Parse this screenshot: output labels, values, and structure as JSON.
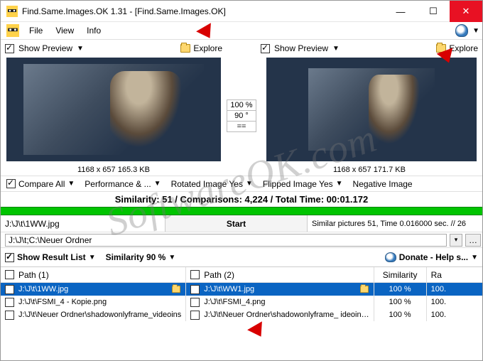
{
  "window": {
    "title": "Find.Same.Images.OK 1.31 - [Find.Same.Images.OK]",
    "min": "—",
    "max": "☐",
    "close": "✕"
  },
  "menu": {
    "file": "File",
    "view": "View",
    "info": "Info"
  },
  "preview": {
    "show": "Show Preview",
    "explore": "Explore",
    "left_info": "1168 x 657 165.3 KB",
    "right_info": "1168 x 657 171.7 KB",
    "zoom": "100 %",
    "rot": "90 °",
    "eq": "=="
  },
  "opts": {
    "compare": "Compare All",
    "perf": "Performance & ...",
    "rotated": "Rotated Image Yes",
    "flipped": "Flipped Image Yes",
    "negative": "Negative Image"
  },
  "summary": "Similarity: 51 / Comparisons: 4,224 / Total Time: 00:01.172",
  "control": {
    "current_path": "J:\\J\\t\\1WW.jpg",
    "start": "Start",
    "status": "Similar pictures 51, Time 0.016000 sec. // 26"
  },
  "scan_paths": "J:\\J\\t;C:\\Neuer Ordner",
  "result_opts": {
    "show_list": "Show Result List",
    "similarity": "Similarity 90 %",
    "donate": "Donate - Help s..."
  },
  "headers": {
    "path1": "Path (1)",
    "path2": "Path (2)",
    "sim": "Similarity",
    "ra": "Ra"
  },
  "rows": [
    {
      "p1": "J:\\J\\t\\1WW.jpg",
      "p2": "J:\\J\\t\\WW1.jpg",
      "sim": "100 %",
      "ra": "100.",
      "selected": true
    },
    {
      "p1": "J:\\J\\t\\FSMI_4 - Kopie.png",
      "p2": "J:\\J\\t\\FSMI_4.png",
      "sim": "100 %",
      "ra": "100.",
      "selected": false
    },
    {
      "p1": "J:\\J\\t\\Neuer Ordner\\shadowonlyframe_videoins",
      "p2": "J:\\J\\t\\Neuer Ordner\\shadowonlyframe_ ideoin…",
      "sim": "100 %",
      "ra": "100.",
      "selected": false
    }
  ],
  "watermark": "SoftwareOK.com"
}
